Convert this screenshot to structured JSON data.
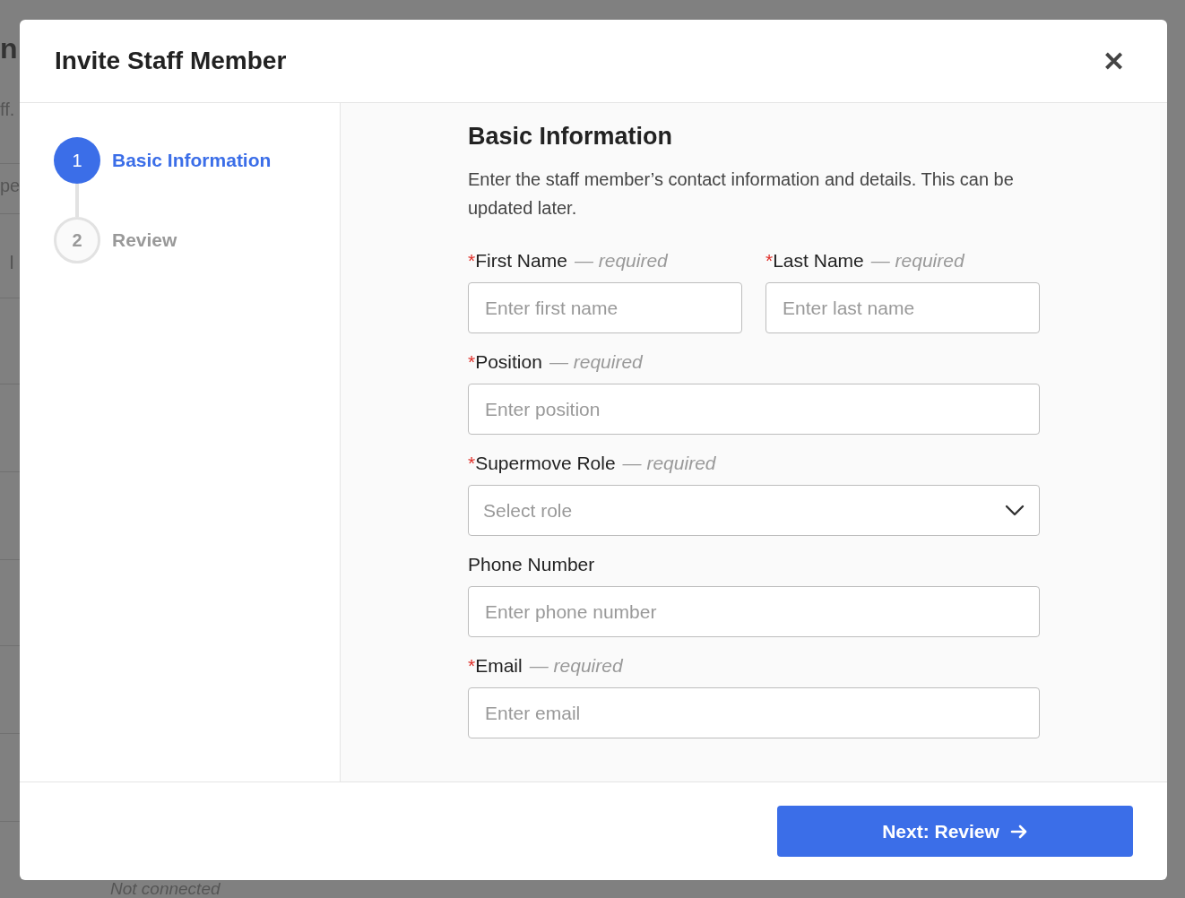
{
  "background": {
    "texts": [
      "n",
      "ff.",
      "pe",
      "I"
    ],
    "status": "Not connected"
  },
  "modal": {
    "title": "Invite Staff Member",
    "close": "✕",
    "steps": [
      {
        "number": "1",
        "label": "Basic Information",
        "selected": true
      },
      {
        "number": "2",
        "label": "Review",
        "selected": false
      }
    ],
    "section": {
      "title": "Basic Information",
      "description": "Enter the staff member’s contact information and details. This can be updated later."
    },
    "field_rows": [
      [
        {
          "kind": "text",
          "marker": "*",
          "label": "First Name",
          "note": "— required",
          "placeholder": "Enter first name"
        },
        {
          "kind": "text",
          "marker": "*",
          "label": "Last Name",
          "note": "— required",
          "placeholder": "Enter last name"
        }
      ],
      [
        {
          "kind": "text",
          "marker": "*",
          "label": "Position",
          "note": "— required",
          "placeholder": "Enter position"
        }
      ],
      [
        {
          "kind": "select",
          "marker": "*",
          "label": "Supermove Role",
          "note": "— required",
          "placeholder": "Select role"
        }
      ],
      [
        {
          "kind": "text",
          "label": "Phone Number",
          "placeholder": "Enter phone number"
        }
      ],
      [
        {
          "kind": "text",
          "marker": "*",
          "label": "Email",
          "note": "— required",
          "placeholder": "Enter email"
        }
      ]
    ],
    "next_button": "Next: Review"
  }
}
